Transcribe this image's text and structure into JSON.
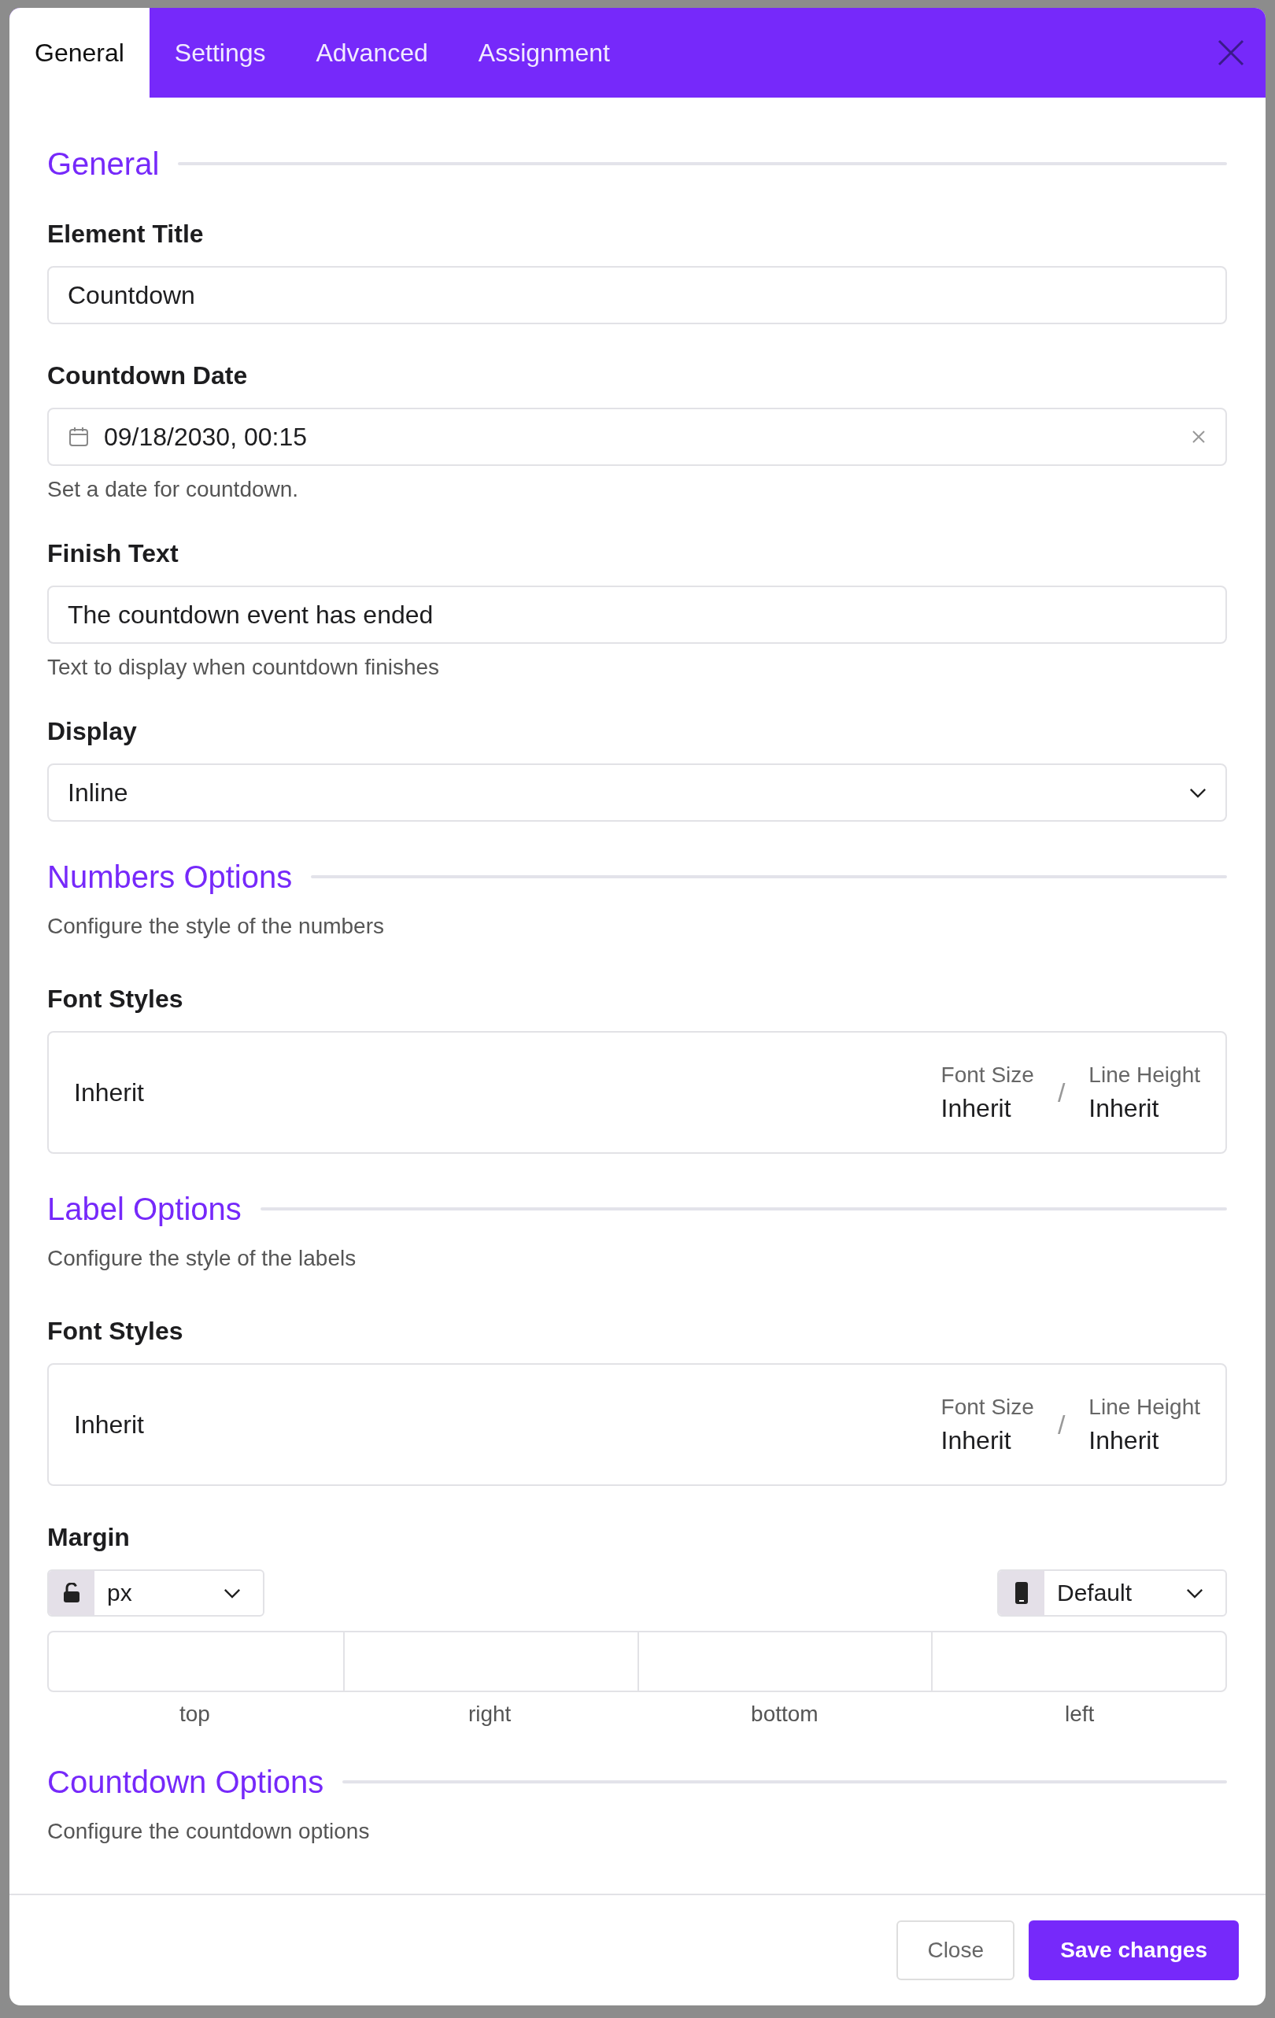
{
  "tabs": [
    {
      "label": "General",
      "selected": true
    },
    {
      "label": "Settings",
      "selected": false
    },
    {
      "label": "Advanced",
      "selected": false
    },
    {
      "label": "Assignment",
      "selected": false
    }
  ],
  "sections": [
    {
      "heading": "General",
      "fields": [
        {
          "kind": "text",
          "label": "Element Title",
          "value": "Countdown"
        },
        {
          "kind": "date",
          "label": "Countdown Date",
          "value": "09/18/2030, 00:15",
          "help": "Set a date for countdown."
        },
        {
          "kind": "text",
          "label": "Finish Text",
          "value": "The countdown event has ended",
          "help": "Text to display when countdown finishes"
        },
        {
          "kind": "select",
          "label": "Display",
          "value": "Inline"
        }
      ]
    },
    {
      "heading": "Numbers Options",
      "description": "Configure the style of the numbers",
      "fields": [
        {
          "kind": "font_styles",
          "label": "Font Styles",
          "value": "Inherit",
          "font_size_label": "Font Size",
          "font_size": "Inherit",
          "separator": "/",
          "line_height_label": "Line Height",
          "line_height": "Inherit"
        }
      ]
    },
    {
      "heading": "Label Options",
      "description": "Configure the style of the labels",
      "fields": [
        {
          "kind": "font_styles",
          "label": "Font Styles",
          "value": "Inherit",
          "font_size_label": "Font Size",
          "font_size": "Inherit",
          "separator": "/",
          "line_height_label": "Line Height",
          "line_height": "Inherit"
        },
        {
          "kind": "margin",
          "label": "Margin",
          "unit": "px",
          "device": "Default",
          "sides": [
            "top",
            "right",
            "bottom",
            "left"
          ]
        }
      ]
    },
    {
      "heading": "Countdown Options",
      "description": "Configure the countdown options"
    }
  ],
  "footer": {
    "buttons": [
      {
        "label": "Close",
        "kind": "secondary"
      },
      {
        "label": "Save changes",
        "kind": "primary"
      }
    ]
  }
}
